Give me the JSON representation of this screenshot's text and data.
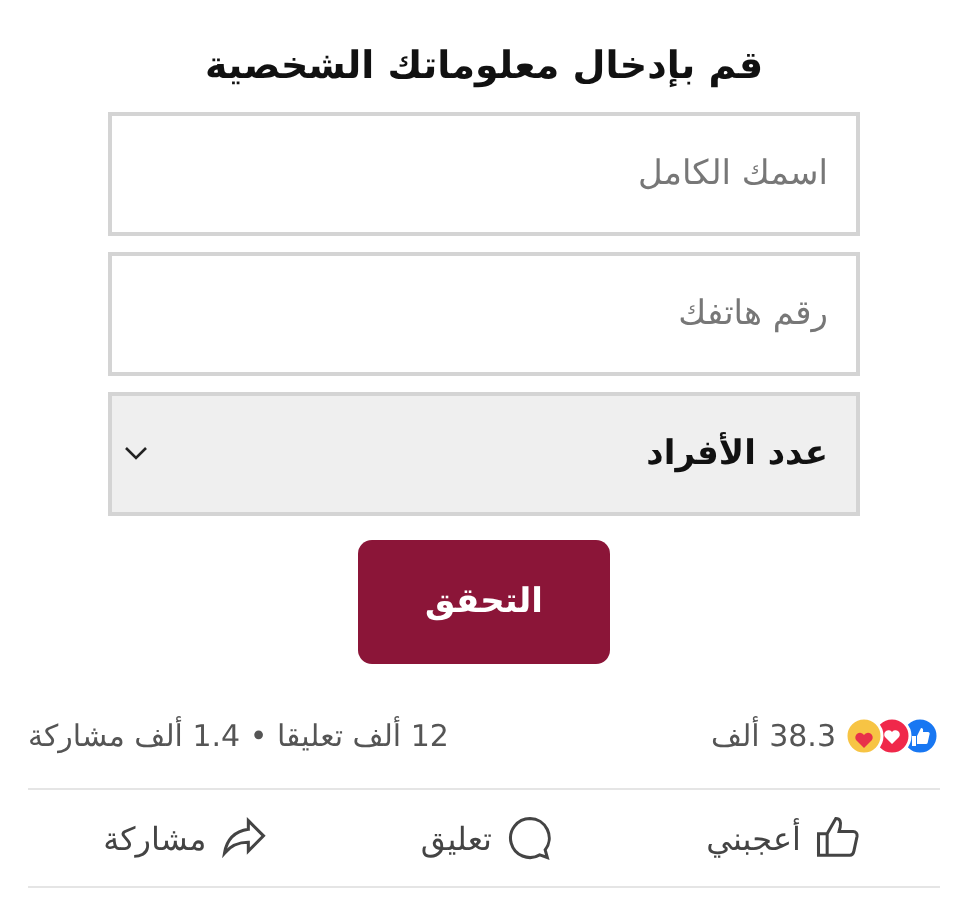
{
  "form": {
    "title": "قم بإدخال معلوماتك الشخصية",
    "fields": [
      {
        "kind": "text",
        "placeholder": "اسمك الكامل"
      },
      {
        "kind": "text",
        "placeholder": "رقم هاتفك"
      },
      {
        "kind": "select",
        "value": "عدد الأفراد"
      }
    ],
    "submit": "التحقق"
  },
  "post_stats": {
    "reactions": "38.3 ألف",
    "engagement": "12 ألف تعليقا • 1.4 ألف مشاركة"
  },
  "actions": [
    {
      "kind": "like",
      "label": "أعجبني"
    },
    {
      "kind": "comment",
      "label": "تعليق"
    },
    {
      "kind": "share",
      "label": "مشاركة"
    }
  ]
}
